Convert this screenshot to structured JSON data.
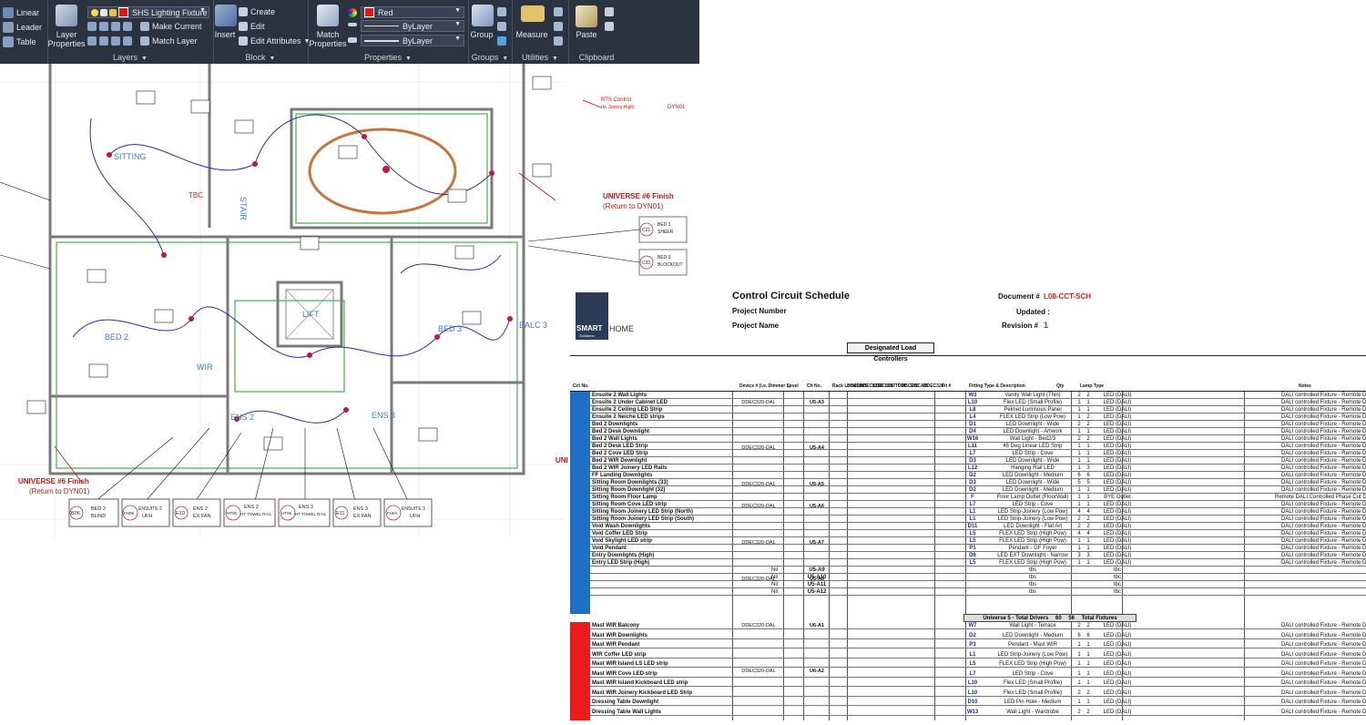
{
  "ribbon": {
    "annotation": {
      "linear": "Linear",
      "leader": "Leader",
      "table": "Table"
    },
    "layers": {
      "title": "Layers",
      "layer_properties": "Layer\nProperties",
      "current_layer": "SHS Lighting Fixture",
      "make_current": "Make Current",
      "match_layer": "Match Layer"
    },
    "block": {
      "title": "Block",
      "insert": "Insert",
      "create": "Create",
      "edit": "Edit",
      "edit_attributes": "Edit Attributes"
    },
    "properties": {
      "title": "Properties",
      "match_properties": "Match\nProperties",
      "color": "Red",
      "linetype": "ByLayer",
      "lineweight": "ByLayer"
    },
    "groups": {
      "title": "Groups",
      "group": "Group"
    },
    "utilities": {
      "title": "Utilities",
      "measure": "Measure"
    },
    "clipboard": {
      "title": "Clipboard",
      "paste": "Paste"
    }
  },
  "drawing": {
    "rooms": {
      "sitting": "SITTING",
      "bed2": "BED 2",
      "bed3": "BED 3",
      "wir": "WIR",
      "ens2": "ENS 2",
      "ens3": "ENS 3",
      "lift": "LIFT",
      "balc3": "BALC 3",
      "tbc": "TBC",
      "stair": "STAIR"
    },
    "universe_finish_1": "UNIVERSE #6 Finish",
    "universe_finish_1_sub": "(Return to DYN01)",
    "universe_finish_2": "UNIVERSE #6 Finish",
    "universe_finish_2_sub": "(Return to DYN01)",
    "universe_edge": "UNI",
    "rts_control": "RTS Control",
    "rts_control_sub": "(In Joinery High)",
    "dyn01": "DYN01",
    "bed3_labels": [
      {
        "code": "C21",
        "title": "BED 3",
        "sub": "SHEER"
      },
      {
        "code": "C20",
        "title": "BED 3",
        "sub": "BLOCKOUT"
      }
    ],
    "bottom_labels": [
      {
        "code": "B06",
        "line1": "BED 2",
        "line2": "BLIND"
      },
      {
        "code": "FH05",
        "line1": "ENSUITE 2",
        "line2": "UFH"
      },
      {
        "code": "E10",
        "line1": "ENS 2",
        "line2": "EX FAN"
      },
      {
        "code": "HT05",
        "line1": "ENS 2",
        "line2": "HT TOWEL RAIL"
      },
      {
        "code": "HT06",
        "line1": "ENS 3",
        "line2": "HT TOWEL RAIL"
      },
      {
        "code": "E11",
        "line1": "ENS 3",
        "line2": "EX FAN"
      },
      {
        "code": "FH04",
        "line1": "ENSUITE 3",
        "line2": "UFH"
      }
    ]
  },
  "schedule": {
    "logo_a": "SMART",
    "logo_b": "HOME",
    "logo_c": "Solutions",
    "title": "Control Circuit Schedule",
    "project_number_label": "Project Number",
    "project_name_label": "Project Name",
    "document_label": "Document #",
    "document_value": "L08-CCT-SCH",
    "updated_label": "Updated :",
    "revision_label": "Revision #",
    "revision_value": "1",
    "group_header": "Designated Load Controllers",
    "headers": {
      "cct": "Cct No.",
      "device": "Device # (i.e. Dimmer 1)",
      "level": "Level",
      "ch": "Ch No.",
      "rack": "Rack Location",
      "fit": "Fit #",
      "type": "Fitting Type & Description",
      "qty": "Qty",
      "lamp": "Lamp Type",
      "notes": "Notes"
    },
    "controllers": [
      "DDEC320",
      "DDEC1228",
      "DDEC320T",
      "LVA-TOM",
      "DDBC210",
      "DBCAN",
      "DDEC320"
    ],
    "totals_label": "Universe 5 - Total Drivers",
    "totals_a": "60",
    "totals_b": "56",
    "totals_c": "Total Fixtures",
    "section1_rows": [
      {
        "desc": "Ensuite 2 Wall Lights",
        "fit": "W3",
        "type": "Vanity Wall Light (Thin)",
        "q1": "2",
        "q2": "2",
        "lamp": "LED (DALI)",
        "notes": "DALI controlled Fixture - Remote Driver"
      },
      {
        "desc": "Ensuite 2 Under Cabinet LED",
        "fit": "L10",
        "type": "Flex LED (Small Profile)",
        "q1": "1",
        "q2": "1",
        "lamp": "LED (DALI)",
        "notes": "DALI controlled Fixture - Remote Driver"
      },
      {
        "desc": "Ensuite 2 Ceiling LED Strip",
        "fit": "L8",
        "type": "Pelmet Luminous Panel",
        "q1": "1",
        "q2": "1",
        "lamp": "LED (DALI)",
        "notes": "DALI controlled Fixture - Remote Driver"
      },
      {
        "desc": "Ensuite 2 Neiche LED strips",
        "fit": "L4",
        "type": "FLEX LED Strip (Low Pow)",
        "q1": "1",
        "q2": "2",
        "lamp": "LED (DALI)",
        "notes": "DALI controlled Fixture - Remote Driver"
      },
      {
        "desc": "Bed 2 Downlights",
        "fit": "D1",
        "type": "LED Downlight - Wide",
        "q1": "2",
        "q2": "2",
        "lamp": "LED (DALI)",
        "notes": "DALI controlled Fixture - Remote Driver"
      },
      {
        "desc": "Bed 2 Desk Downlight",
        "fit": "D4",
        "type": "LED Downlight - Artwork",
        "q1": "1",
        "q2": "1",
        "lamp": "LED (DALI)",
        "notes": "DALI controlled Fixture - Remote Driver"
      },
      {
        "desc": "Bed 2 Wall Lights",
        "fit": "W16",
        "type": "Wall Light - Bed2/3",
        "q1": "2",
        "q2": "2",
        "lamp": "LED (DALI)",
        "notes": "DALI controlled Fixture - Remote Driver"
      },
      {
        "desc": "Bed 2 Desk LED Strip",
        "fit": "L11",
        "type": "45 Deg Linear LED Strip",
        "q1": "1",
        "q2": "1",
        "lamp": "LED (DALI)",
        "notes": "DALI controlled Fixture - Remote Driver"
      },
      {
        "desc": "Bed 2 Cove LED Strip",
        "fit": "L7",
        "type": "LED Strip - Cove",
        "q1": "1",
        "q2": "1",
        "lamp": "LED (DALI)",
        "notes": "DALI controlled Fixture - Remote Driver"
      },
      {
        "desc": "Bed 2 WIR Downlight",
        "fit": "D3",
        "type": "LED Downlight - Wide",
        "q1": "1",
        "q2": "1",
        "lamp": "LED (DALI)",
        "notes": "DALI controlled Fixture - Remote Driver"
      },
      {
        "desc": "Bed 2 WIR Joinery LED Rails",
        "fit": "L12",
        "type": "Hanging Rail LED",
        "q1": "1",
        "q2": "3",
        "lamp": "LED (DALI)",
        "notes": "DALI controlled Fixture - Remote Driver"
      },
      {
        "desc": "FF Landing Downlights",
        "fit": "D2",
        "type": "LED Downlight - Medium",
        "q1": "6",
        "q2": "6",
        "lamp": "LED (DALI)",
        "notes": "DALI controlled Fixture - Remote Driver"
      },
      {
        "desc": "Sitting Room Downlights (33)",
        "fit": "D3",
        "type": "LED Downlight - Wide",
        "q1": "5",
        "q2": "5",
        "lamp": "LED (DALI)",
        "notes": "DALI controlled Fixture - Remote Driver"
      },
      {
        "desc": "Sitting Room Downlight (32)",
        "fit": "D2",
        "type": "LED Downlight - Medium",
        "q1": "1",
        "q2": "1",
        "lamp": "LED (DALI)",
        "notes": "DALI controlled Fixture - Remote Driver"
      },
      {
        "desc": "Sitting Room Floor Lamp",
        "fit": "F",
        "type": "Floor Lamp Outlet (FloorWall)",
        "q1": "1",
        "q2": "1",
        "lamp": "BYE Outlet",
        "notes": "Remote DALI Controlled Phase Cut Dimmer"
      },
      {
        "desc": "Sitting Room Cove LED strip",
        "fit": "L7",
        "type": "LED Strip - Cove",
        "q1": "1",
        "q2": "1",
        "lamp": "LED (DALI)",
        "notes": "DALI controlled Fixture - Remote Driver"
      },
      {
        "desc": "Sitting Room Joinery LED Strip (North)",
        "fit": "L1",
        "type": "LED Strip-Joinery (Low Pow)",
        "q1": "4",
        "q2": "4",
        "lamp": "LED (DALI)",
        "notes": "DALI controlled Fixture - Remote Driver"
      },
      {
        "desc": "Sitting Room Joinery LED Strip (South)",
        "fit": "L1",
        "type": "LED Strip-Joinery (Low Pow)",
        "q1": "2",
        "q2": "2",
        "lamp": "LED (DALI)",
        "notes": "DALI controlled Fixture - Remote Driver"
      },
      {
        "desc": "Void Wash Downlights",
        "fit": "D11",
        "type": "LED Downlight - Flat Art",
        "q1": "2",
        "q2": "2",
        "lamp": "LED (DALI)",
        "notes": "DALI controlled Fixture - Remote Driver"
      },
      {
        "desc": "Void Coffer LED Strip",
        "fit": "L5",
        "type": "FLEX LED Strip (High Pow)",
        "q1": "4",
        "q2": "4",
        "lamp": "LED (DALI)",
        "notes": "DALI controlled Fixture - Remote Driver"
      },
      {
        "desc": "Void Skylight LED strip",
        "fit": "L5",
        "type": "FLEX LED Strip (High Pow)",
        "q1": "1",
        "q2": "1",
        "lamp": "LED (DALI)",
        "notes": "DALI controlled Fixture - Remote Driver"
      },
      {
        "desc": "Void Pendant",
        "fit": "P1",
        "type": "Pendant - GF Foyer",
        "q1": "1",
        "q2": "1",
        "lamp": "LED (DALI)",
        "notes": "DALI controlled Fixture - Remote Driver"
      },
      {
        "desc": "Entry Downlights (High)",
        "fit": "D6",
        "type": "LED EXT Downlight - Narrow",
        "q1": "3",
        "q2": "3",
        "lamp": "LED (DALI)",
        "notes": "DALI controlled Fixture - Remote Driver"
      },
      {
        "desc": "Entry LED Strip (High)",
        "fit": "L5",
        "type": "FLEX LED Strip (High Pow)",
        "q1": "1",
        "q2": "1",
        "lamp": "LED (DALI)",
        "notes": "DALI controlled Fixture - Remote Driver"
      }
    ],
    "section1_devices": [
      {
        "device": "DDEC320-DAL",
        "ch": "U5-A3"
      },
      {
        "device": "DDEC320-DAL",
        "ch": "U5-A4"
      },
      {
        "device": "DDEC320-DAL",
        "ch": "U5-A5"
      },
      {
        "device": "DDEC320-DAL",
        "ch": "U5-A6"
      },
      {
        "device": "DDEC320-DAL",
        "ch": "U5-A7"
      },
      {
        "device": "DDEC320-DAL",
        "ch": "U5-A8"
      }
    ],
    "nil_rows": [
      {
        "level": "Nil",
        "ch": "U5-A9",
        "type": "tbs",
        "lamp": "tbc"
      },
      {
        "level": "Nil",
        "ch": "U5-A10",
        "type": "tbs",
        "lamp": "tbc"
      },
      {
        "level": "Nil",
        "ch": "U5-A11",
        "type": "tbs",
        "lamp": "tbc"
      },
      {
        "level": "Nil",
        "ch": "U5-A12",
        "type": "tbs",
        "lamp": "tbc"
      }
    ],
    "section2_rows": [
      {
        "desc": "Mast WIR Balcony",
        "fit": "W7",
        "type": "Wall Light - Terrace",
        "q1": "2",
        "q2": "2",
        "lamp": "LED (DALI)",
        "notes": "DALI controlled Fixture - Remote Driver"
      },
      {
        "desc": "Mast WIR Downlights",
        "fit": "D2",
        "type": "LED Downlight - Medium",
        "q1": "6",
        "q2": "6",
        "lamp": "LED (DALI)",
        "notes": "DALI controlled Fixture - Remote Driver"
      },
      {
        "desc": "Mast WIR Pendant",
        "fit": "P3",
        "type": "Pendant - Mast WIR",
        "q1": "1",
        "q2": "1",
        "lamp": "LED (DALI)",
        "notes": "DALI controlled Fixture - Remote Driver"
      },
      {
        "desc": "WIR Coffer LED strip",
        "fit": "L1",
        "type": "LED Strip-Joinery (Low Pow)",
        "q1": "1",
        "q2": "1",
        "lamp": "LED (DALI)",
        "notes": "DALI controlled Fixture - Remote Driver"
      },
      {
        "desc": "Mast WIR Island LS LED strip",
        "fit": "L5",
        "type": "FLEX LED Strip (High Pow)",
        "q1": "1",
        "q2": "1",
        "lamp": "LED (DALI)",
        "notes": "DALI controlled Fixture - Remote Driver"
      },
      {
        "desc": "Mast WIR Cove LED strip",
        "fit": "L7",
        "type": "LED Strip - Cove",
        "q1": "1",
        "q2": "1",
        "lamp": "LED (DALI)",
        "notes": "DALI controlled Fixture - Remote Driver"
      },
      {
        "desc": "Mast WIR Island Kickboard LED strip",
        "fit": "L10",
        "type": "Flex LED (Small Profile)",
        "q1": "1",
        "q2": "1",
        "lamp": "LED (DALI)",
        "notes": "DALI controlled Fixture - Remote Driver"
      },
      {
        "desc": "Mast WIR Joinery Kickboard LED Strip",
        "fit": "L10",
        "type": "Flex LED (Small Profile)",
        "q1": "2",
        "q2": "2",
        "lamp": "LED (DALI)",
        "notes": "DALI controlled Fixture - Remote Driver"
      },
      {
        "desc": "Dressing Table Downlight",
        "fit": "D10",
        "type": "LED Pin Hole - Medium",
        "q1": "1",
        "q2": "1",
        "lamp": "LED (DALI)",
        "notes": "DALI controlled Fixture - Remote Driver"
      },
      {
        "desc": "Dressing Table Wall Lights",
        "fit": "W13",
        "type": "Wall Light - Wardrobe",
        "q1": "2",
        "q2": "2",
        "lamp": "LED (DALI)",
        "notes": "DALI controlled Fixture - Remote Driver"
      }
    ],
    "section2_device": {
      "device": "DDEC320-DAL",
      "ch": "U6-A1"
    },
    "section2_device_b": {
      "device": "DDEC320-DAL",
      "ch": "U6-A2"
    },
    "colors": {
      "section1": "#1f6fc5",
      "section2": "#e81c1c"
    }
  }
}
